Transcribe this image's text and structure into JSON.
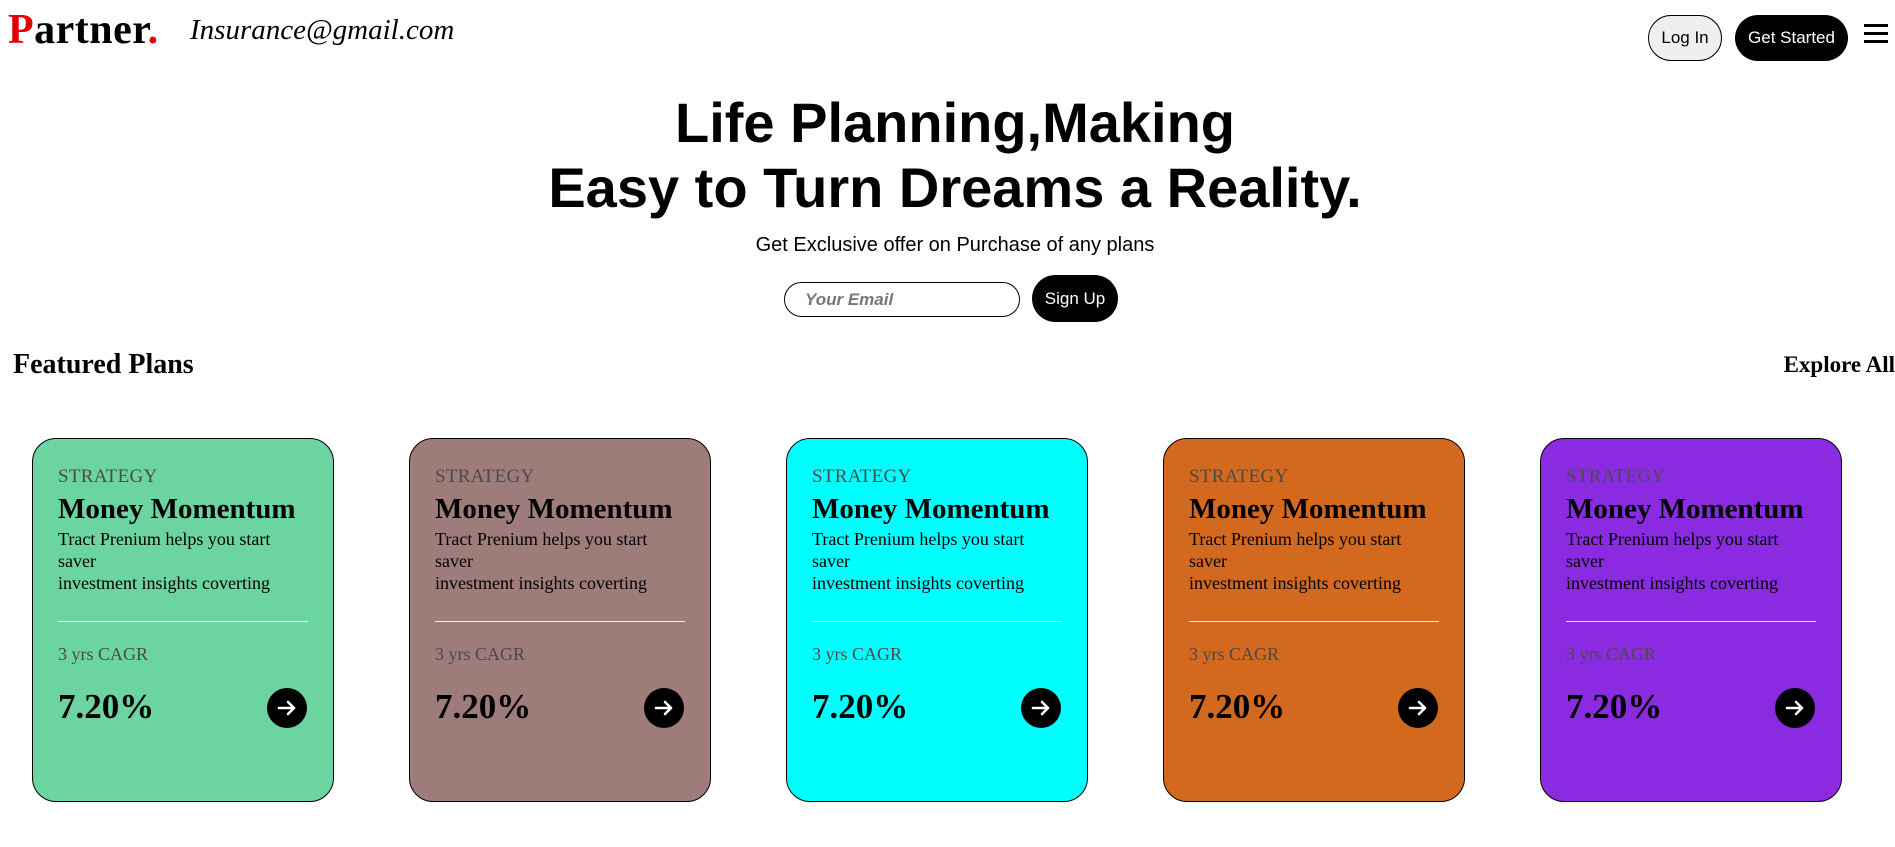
{
  "header": {
    "logo_first": "P",
    "logo_rest": "artner",
    "logo_dot": ".",
    "contact_email": "Insurance@gmail.com",
    "login_label": "Log In",
    "get_started_label": "Get Started"
  },
  "hero": {
    "title_line1": "Life Planning,Making",
    "title_line2": "Easy to Turn Dreams a Reality.",
    "subtitle": "Get Exclusive offer on Purchase of any plans",
    "email_placeholder": "Your Email",
    "signup_label": "Sign Up"
  },
  "featured": {
    "title": "Featured Plans",
    "explore_label": "Explore All",
    "cards": [
      {
        "label": "STRATEGY",
        "title": "Money Momentum",
        "desc_line1": "Tract Prenium helps you start",
        "desc_line2": "saver",
        "desc_line3": "investment insights coverting",
        "cagr_label": "3 yrs CAGR",
        "value": "7.20%",
        "color": "#6cd4a1"
      },
      {
        "label": "STRATEGY",
        "title": "Money Momentum",
        "desc_line1": "Tract Prenium helps you start",
        "desc_line2": "saver",
        "desc_line3": "investment insights coverting",
        "cagr_label": "3 yrs CAGR",
        "value": "7.20%",
        "color": "#9e7c7a"
      },
      {
        "label": "STRATEGY",
        "title": "Money Momentum",
        "desc_line1": "Tract Prenium helps you start",
        "desc_line2": "saver",
        "desc_line3": "investment insights coverting",
        "cagr_label": "3 yrs CAGR",
        "value": "7.20%",
        "color": "#00ffff"
      },
      {
        "label": "STRATEGY",
        "title": "Money Momentum",
        "desc_line1": "Tract Prenium helps you start",
        "desc_line2": "saver",
        "desc_line3": "investment insights coverting",
        "cagr_label": "3 yrs CAGR",
        "value": "7.20%",
        "color": "#d2691e"
      },
      {
        "label": "STRATEGY",
        "title": "Money Momentum",
        "desc_line1": "Tract Prenium helps you start",
        "desc_line2": "saver",
        "desc_line3": "investment insights coverting",
        "cagr_label": "3 yrs CAGR",
        "value": "7.20%",
        "color": "#8a2be2"
      }
    ]
  },
  "icons": {
    "menu": "hamburger-menu-icon",
    "card_action": "arrow-right-icon"
  }
}
